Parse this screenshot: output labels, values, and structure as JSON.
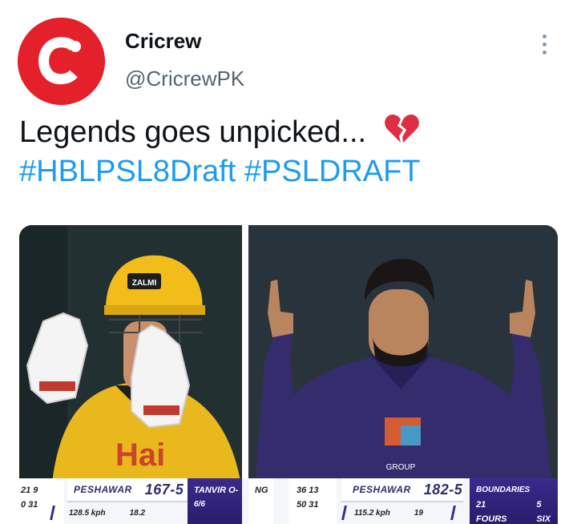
{
  "tweet": {
    "display_name": "Cricrew",
    "handle": "@CricrewPK",
    "text_line1": "Legends goes unpicked...",
    "text_line2": "#HBLPSL8Draft #PSLDRAFT",
    "emoji": "broken-heart"
  },
  "brand": {
    "avatar_color": "#e4202b",
    "link_color": "#1d9bf0"
  },
  "media": {
    "left": {
      "helmet_text": "ZALMI",
      "score_left_top": "21 9",
      "score_left_bottom": "0 31",
      "team": "PESHAWAR",
      "score": "167-5",
      "speed": "128.5 kph",
      "overs": "18.2",
      "batter_label": "TANVIR O-",
      "batter_figures": "6/6"
    },
    "right": {
      "batter_line1": "36 13",
      "batter_line2": "50 31",
      "team": "PESHAWAR",
      "score": "182-5",
      "speed": "115.2 kph",
      "overs": "19",
      "panel_title": "BOUNDARIES",
      "panel_fours": "21 FOURS",
      "panel_sixes": "5 SIX",
      "panel_left_fragment": "NG",
      "shirt_logo": "GROUP"
    }
  }
}
